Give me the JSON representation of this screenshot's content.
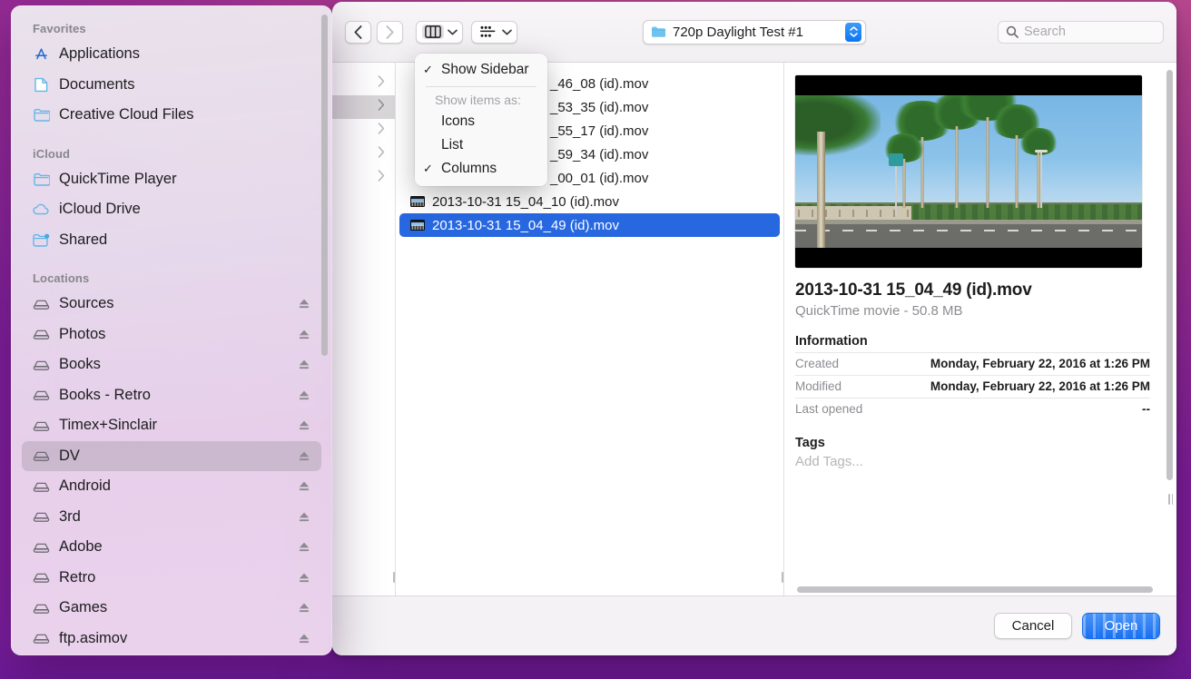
{
  "window": {
    "title": "Open file dialog"
  },
  "toolbar": {
    "back_icon": "chevron-left-icon",
    "forward_icon": "chevron-right-icon",
    "view_icon": "columns-view-icon",
    "group_icon": "group-items-icon",
    "path": "720p Daylight Test #1",
    "path_icon": "folder-icon",
    "search_placeholder": "Search",
    "search_value": "",
    "search_icon": "search-icon"
  },
  "view_menu": {
    "show_sidebar": "Show Sidebar",
    "show_sidebar_checked": true,
    "section_label": "Show items as:",
    "options": [
      {
        "label": "Icons",
        "checked": false
      },
      {
        "label": "List",
        "checked": false
      },
      {
        "label": "Columns",
        "checked": true
      }
    ]
  },
  "sidebar": {
    "sections": [
      {
        "header": "Favorites",
        "items": [
          {
            "label": "Applications",
            "icon": "app-store-icon",
            "eject": false,
            "selected": false
          },
          {
            "label": "Documents",
            "icon": "document-icon",
            "eject": false,
            "selected": false
          },
          {
            "label": "Creative Cloud Files",
            "icon": "folder-icon",
            "eject": false,
            "selected": false
          }
        ]
      },
      {
        "header": "iCloud",
        "items": [
          {
            "label": "QuickTime Player",
            "icon": "folder-icon",
            "eject": false,
            "selected": false
          },
          {
            "label": "iCloud Drive",
            "icon": "cloud-icon",
            "eject": false,
            "selected": false
          },
          {
            "label": "Shared",
            "icon": "shared-folder-icon",
            "eject": false,
            "selected": false
          }
        ]
      },
      {
        "header": "Locations",
        "items": [
          {
            "label": "Sources",
            "icon": "drive-icon",
            "eject": true,
            "selected": false
          },
          {
            "label": "Photos",
            "icon": "drive-icon",
            "eject": true,
            "selected": false
          },
          {
            "label": "Books",
            "icon": "drive-icon",
            "eject": true,
            "selected": false
          },
          {
            "label": "Books - Retro",
            "icon": "drive-icon",
            "eject": true,
            "selected": false
          },
          {
            "label": "Timex+Sinclair",
            "icon": "drive-icon",
            "eject": true,
            "selected": false
          },
          {
            "label": "DV",
            "icon": "drive-icon",
            "eject": true,
            "selected": true
          },
          {
            "label": "Android",
            "icon": "drive-icon",
            "eject": true,
            "selected": false
          },
          {
            "label": "3rd",
            "icon": "drive-icon",
            "eject": true,
            "selected": false
          },
          {
            "label": "Adobe",
            "icon": "drive-icon",
            "eject": true,
            "selected": false
          },
          {
            "label": "Retro",
            "icon": "drive-icon",
            "eject": true,
            "selected": false
          },
          {
            "label": "Games",
            "icon": "drive-icon",
            "eject": true,
            "selected": false
          },
          {
            "label": "ftp.asimov",
            "icon": "drive-icon",
            "eject": true,
            "selected": false
          }
        ]
      }
    ]
  },
  "column_one": {
    "rows": [
      {
        "icon": "chevron-right-icon",
        "selected": false
      },
      {
        "icon": "chevron-right-icon",
        "selected": true
      },
      {
        "icon": "chevron-right-icon",
        "selected": false
      },
      {
        "icon": "chevron-right-icon",
        "selected": false
      },
      {
        "icon": "chevron-right-icon",
        "selected": false
      }
    ]
  },
  "file_list": {
    "items": [
      {
        "label": "_46_08 (id).mov",
        "selected": false,
        "obscured": true
      },
      {
        "label": "_53_35 (id).mov",
        "selected": false,
        "obscured": true
      },
      {
        "label": "_55_17 (id).mov",
        "selected": false,
        "obscured": true
      },
      {
        "label": "_59_34 (id).mov",
        "selected": false,
        "obscured": true
      },
      {
        "label": "_00_01 (id).mov",
        "selected": false,
        "obscured": true
      },
      {
        "label": "2013-10-31 15_04_10 (id).mov",
        "selected": false,
        "obscured": false
      },
      {
        "label": "2013-10-31 15_04_49 (id).mov",
        "selected": true,
        "obscured": false
      }
    ]
  },
  "preview": {
    "alt": "Daylight video still of palm trees along a suburban street under a clear blue sky"
  },
  "info": {
    "filename": "2013-10-31 15_04_49 (id).mov",
    "kind_and_size": "QuickTime movie - 50.8 MB",
    "information_heading": "Information",
    "rows": [
      {
        "key": "Created",
        "value": "Monday, February 22, 2016 at 1:26 PM"
      },
      {
        "key": "Modified",
        "value": "Monday, February 22, 2016 at 1:26 PM"
      },
      {
        "key": "Last opened",
        "value": "--"
      }
    ],
    "tags_heading": "Tags",
    "tags_placeholder": "Add Tags..."
  },
  "footer": {
    "cancel_label": "Cancel",
    "open_label": "Open"
  },
  "colors": {
    "selection_blue": "#2767e0",
    "primary_button": "#1a6ff0",
    "desktop_magenta": "#b8458f"
  }
}
